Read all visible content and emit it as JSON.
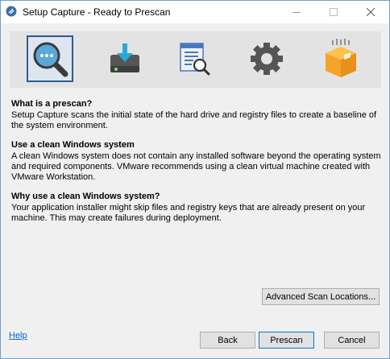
{
  "window": {
    "title": "Setup Capture - Ready to Prescan"
  },
  "steps": [
    {
      "icon": "prescan-magnifier-icon",
      "active": true
    },
    {
      "icon": "install-drive-icon",
      "active": false
    },
    {
      "icon": "document-search-icon",
      "active": false
    },
    {
      "icon": "gear-icon",
      "active": false
    },
    {
      "icon": "package-box-icon",
      "active": false
    }
  ],
  "sections": [
    {
      "heading": "What is a prescan?",
      "body": "Setup Capture scans the initial state of the hard drive and registry files to create a baseline of the system environment."
    },
    {
      "heading": "Use a clean Windows system",
      "body": "A clean Windows system does not contain any installed software beyond the operating system and required components. VMware recommends using a clean virtual machine created with VMware Workstation."
    },
    {
      "heading": "Why use a clean Windows system?",
      "body": "Your application installer might skip files and registry keys that are already present on your machine. This may create failures during deployment."
    }
  ],
  "buttons": {
    "advanced": "Advanced Scan Locations...",
    "back": "Back",
    "prescan": "Prescan",
    "cancel": "Cancel"
  },
  "help": "Help",
  "colors": {
    "accent": "#2f5c8a",
    "focus": "#0078d7",
    "link": "#0066cc"
  }
}
